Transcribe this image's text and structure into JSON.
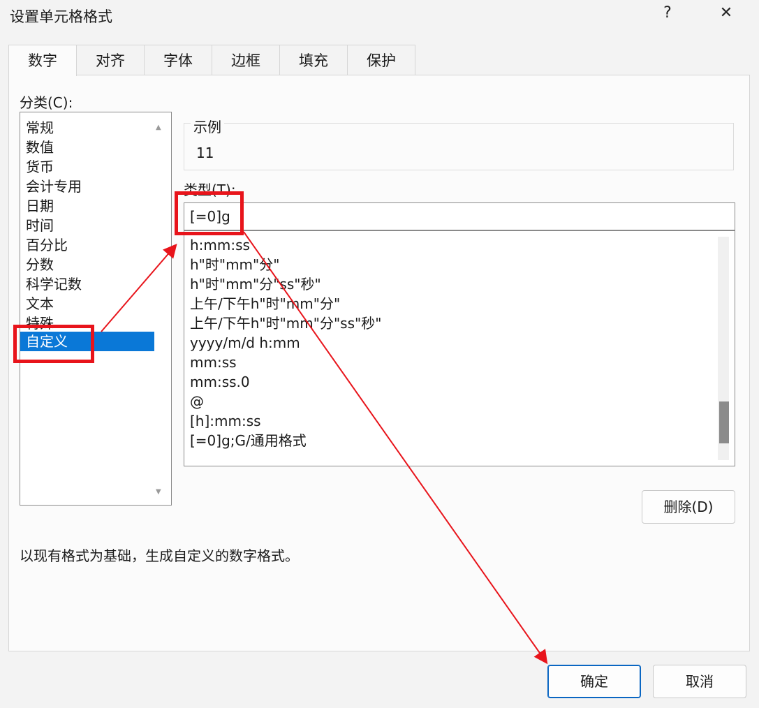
{
  "window": {
    "title": "设置单元格格式",
    "help": "?",
    "close": "✕"
  },
  "tabs": [
    "数字",
    "对齐",
    "字体",
    "边框",
    "填充",
    "保护"
  ],
  "category": {
    "label": "分类(C):",
    "items": [
      "常规",
      "数值",
      "货币",
      "会计专用",
      "日期",
      "时间",
      "百分比",
      "分数",
      "科学记数",
      "文本",
      "特殊",
      "自定义"
    ],
    "selected": "自定义"
  },
  "sample": {
    "label": "示例",
    "value": "11"
  },
  "type": {
    "label": "类型(T):",
    "value": "[=0]g",
    "list": [
      "h:mm:ss",
      "h\"时\"mm\"分\"",
      "h\"时\"mm\"分\"ss\"秒\"",
      "上午/下午h\"时\"mm\"分\"",
      "上午/下午h\"时\"mm\"分\"ss\"秒\"",
      "yyyy/m/d h:mm",
      "mm:ss",
      "mm:ss.0",
      "@",
      "[h]:mm:ss",
      "[=0]g;G/通用格式"
    ]
  },
  "buttons": {
    "delete": "删除(D)",
    "ok": "确定",
    "cancel": "取消"
  },
  "description": "以现有格式为基础，生成自定义的数字格式。",
  "colors": {
    "selection": "#0a78d7",
    "annotation": "#e8141b"
  }
}
